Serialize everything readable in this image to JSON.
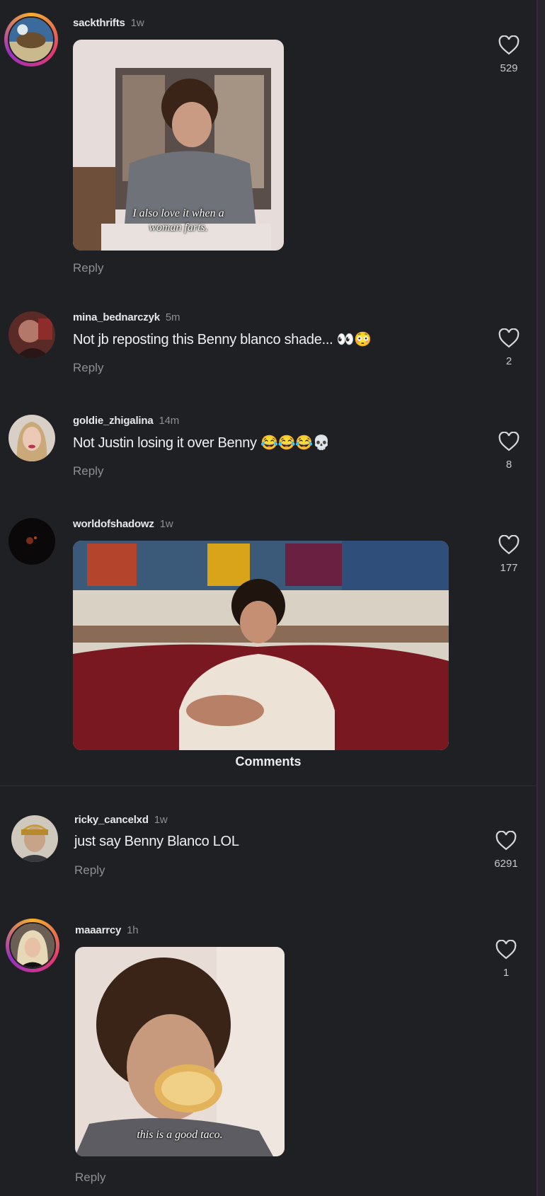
{
  "section_label": "Comments",
  "comments": [
    {
      "username": "sackthrifts",
      "time": "1w",
      "text": "",
      "media_caption": "I also love it when a woman farts.",
      "reply": "Reply",
      "likes": "529"
    },
    {
      "username": "mina_bednarczyk",
      "time": "5m",
      "text": "Not jb reposting this Benny blanco shade... 👀😳",
      "reply": "Reply",
      "likes": "2"
    },
    {
      "username": "goldie_zhigalina",
      "time": "14m",
      "text": "Not Justin losing it over Benny 😂😂😂💀",
      "reply": "Reply",
      "likes": "8"
    },
    {
      "username": "worldofshadowz",
      "time": "1w",
      "text": "",
      "reply": "",
      "likes": "177"
    },
    {
      "username": "ricky_cancelxd",
      "time": "1w",
      "text": "just say Benny Blanco LOL",
      "reply": "Reply",
      "likes": "6291"
    },
    {
      "username": "maaarrcy",
      "time": "1h",
      "text": "",
      "media_caption": "this is a good taco.",
      "reply": "Reply",
      "likes": "1"
    }
  ],
  "colors": {
    "background": "#1f2024",
    "story_ring": "#e23a6e",
    "muted_text": "#8e8e93"
  },
  "icons": {
    "like": "heart-outline-icon"
  }
}
